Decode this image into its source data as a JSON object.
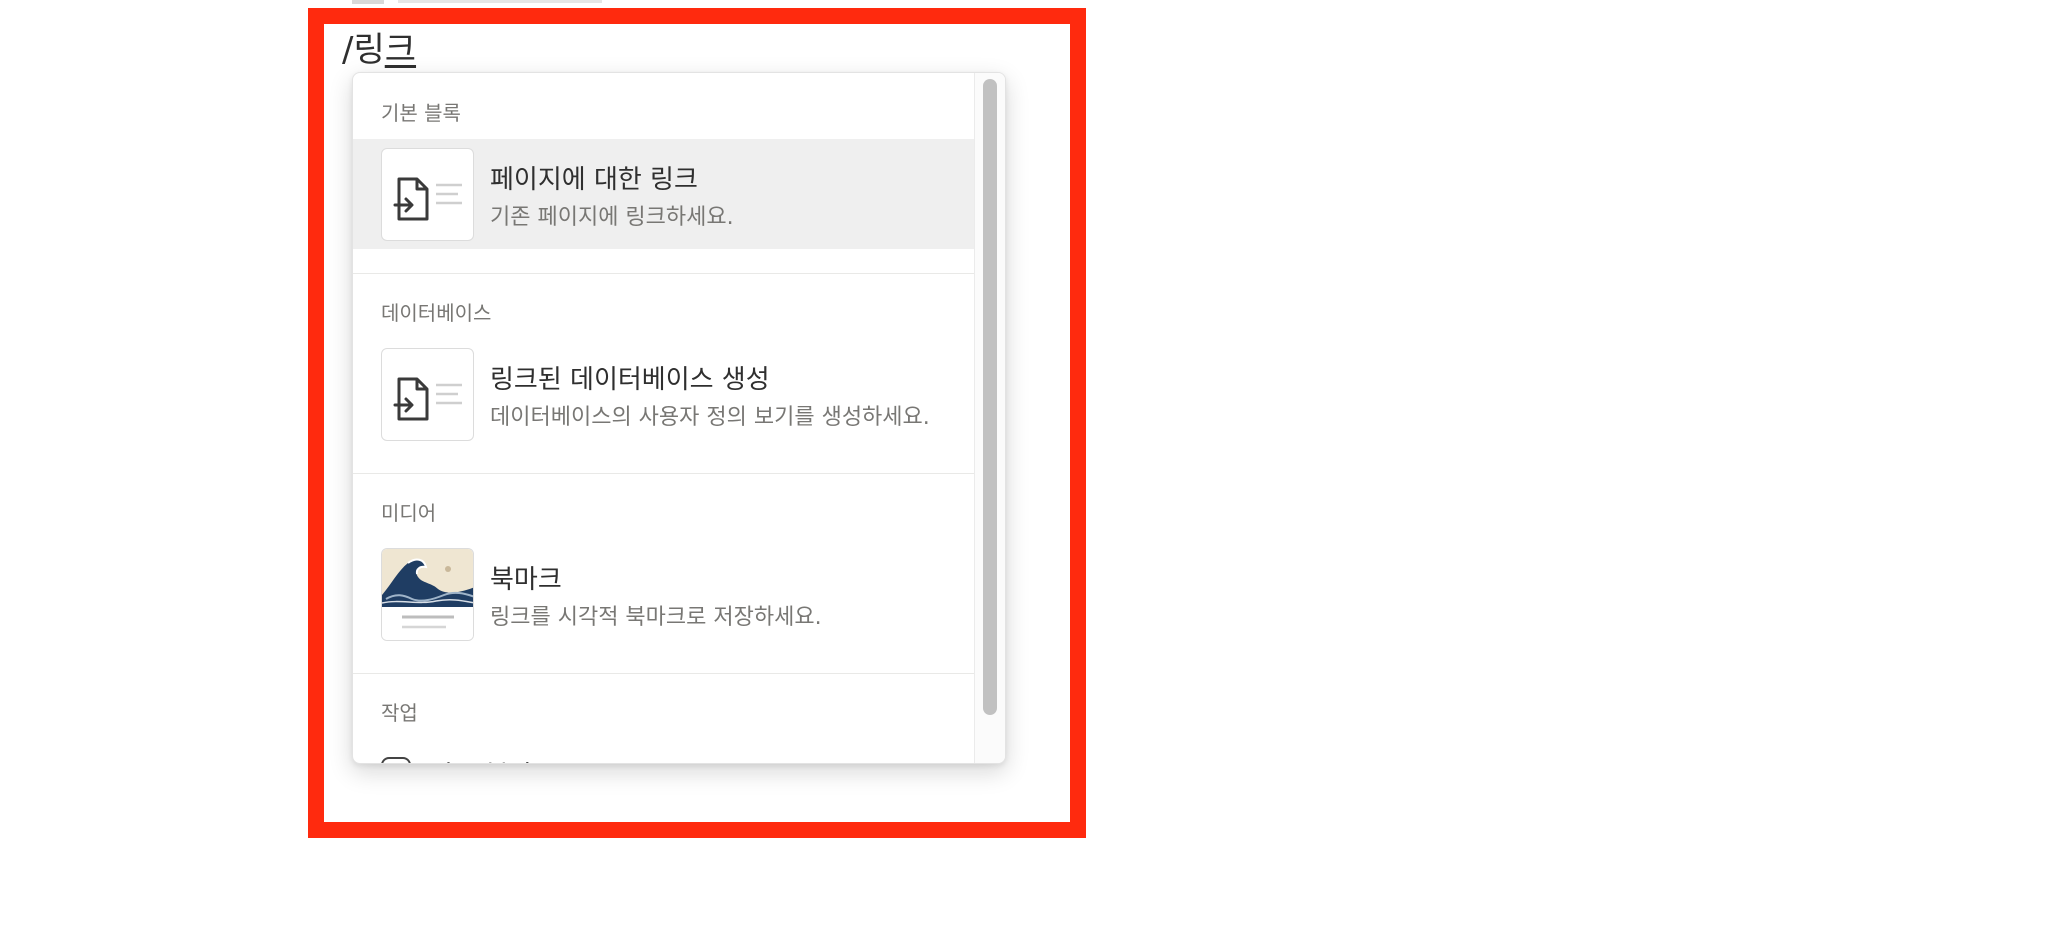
{
  "editor": {
    "slash_prefix": "/링",
    "slash_underlined": "크"
  },
  "menu": {
    "sections": [
      {
        "label": "기본 블록",
        "items": [
          {
            "title": "페이지에 대한 링크",
            "description": "기존 페이지에 링크하세요.",
            "icon": "page-link-icon",
            "active": true
          }
        ]
      },
      {
        "label": "데이터베이스",
        "items": [
          {
            "title": "링크된 데이터베이스 생성",
            "description": "데이터베이스의 사용자 정의 보기를 생성하세요.",
            "icon": "linked-database-icon",
            "active": false
          }
        ]
      },
      {
        "label": "미디어",
        "items": [
          {
            "title": "북마크",
            "description": "링크를 시각적 북마크로 저장하세요.",
            "icon": "bookmark-wave-thumbnail",
            "active": false
          }
        ]
      },
      {
        "label": "작업",
        "items": [
          {
            "title": "링크 복사",
            "icon": "link-icon"
          }
        ]
      }
    ]
  },
  "colors": {
    "highlight_border": "#ff2a0e",
    "active_row": "#efefef",
    "secondary_text": "#787774",
    "primary_text": "#2f2f2f"
  }
}
